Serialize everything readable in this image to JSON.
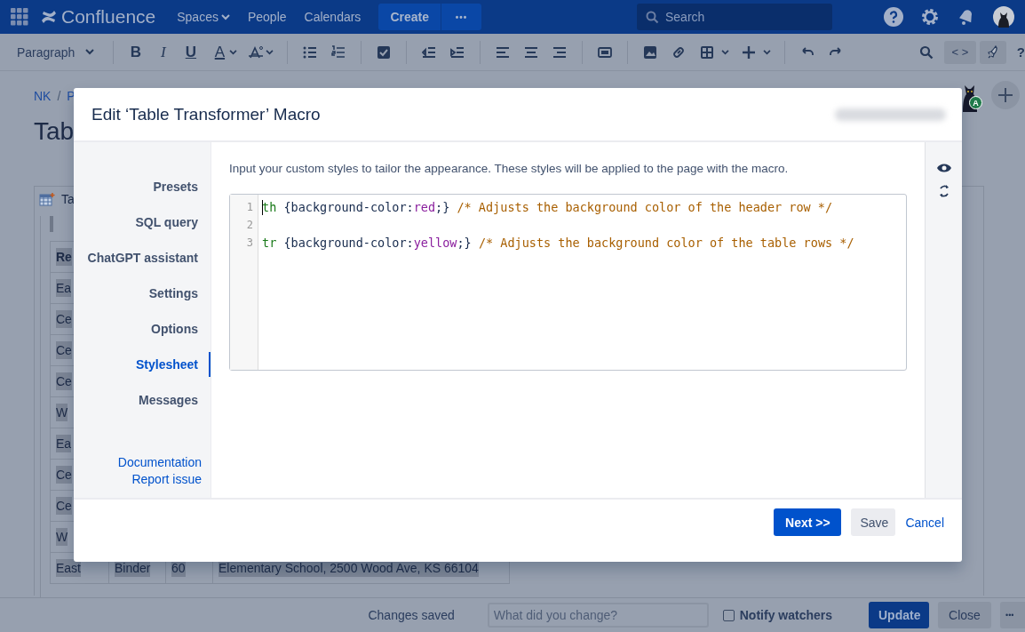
{
  "header": {
    "product": "Confluence",
    "nav": [
      {
        "label": "Spaces",
        "dropdown": true
      },
      {
        "label": "People",
        "dropdown": false
      },
      {
        "label": "Calendars",
        "dropdown": false
      }
    ],
    "create_button": "Create",
    "more_button": "•••",
    "search": {
      "placeholder": "Search"
    }
  },
  "toolbar": {
    "format": "Paragraph",
    "text_buttons": [
      {
        "label": "B",
        "kind": "bold"
      },
      {
        "label": "I",
        "kind": "italic"
      },
      {
        "label": "U",
        "kind": "underline"
      },
      {
        "label": "A",
        "kind": "color"
      }
    ],
    "source_button": "< >",
    "help": "?"
  },
  "page": {
    "breadcrumb": [
      "NK",
      "/",
      "P"
    ],
    "title": "Tab",
    "table_caption": "Ta",
    "table_columns": [
      "Re"
    ],
    "table_rows": [
      [
        "Ea"
      ],
      [
        "Ce"
      ],
      [
        "Ce"
      ],
      [
        "Ce"
      ],
      [
        "W"
      ],
      [
        "Ea"
      ],
      [
        "Ce"
      ],
      [
        "Ce"
      ],
      [
        "W"
      ],
      [
        "East",
        "Binder",
        "60",
        "Elementary School, 2500 Wood Ave, KS 66104"
      ]
    ],
    "avatar_badge": "A"
  },
  "bottom_bar": {
    "status": "Changes saved",
    "comment": {
      "placeholder": "What did you change?"
    },
    "notify": {
      "label": "Notify watchers",
      "checked": false
    },
    "update_button": "Update",
    "close_button": "Close",
    "more_button": "•••"
  },
  "dialog": {
    "title": "Edit ‘Table Transformer’ Macro",
    "nav": [
      {
        "label": "Presets",
        "selected": false
      },
      {
        "label": "SQL query",
        "selected": false
      },
      {
        "label": "ChatGPT assistant",
        "selected": false
      },
      {
        "label": "Settings",
        "selected": false
      },
      {
        "label": "Options",
        "selected": false
      },
      {
        "label": "Stylesheet",
        "selected": true
      },
      {
        "label": "Messages",
        "selected": false
      }
    ],
    "links": [
      "Documentation",
      "Report issue"
    ],
    "description": "Input your custom styles to tailor the appearance. These styles will be applied to the page with the macro.",
    "code_lines": [
      {
        "number": "1",
        "tokens": [
          {
            "kind": "tag",
            "text": "th"
          },
          {
            "kind": "plain",
            "text": " {background-color:"
          },
          {
            "kind": "value",
            "text": "red"
          },
          {
            "kind": "plain",
            "text": ";} "
          },
          {
            "kind": "comment",
            "text": "/* Adjusts the background color of the header row */"
          }
        ]
      },
      {
        "number": "2"
      },
      {
        "number": "3",
        "tokens": [
          {
            "kind": "tag",
            "text": "tr"
          },
          {
            "kind": "plain",
            "text": " {background-color:"
          },
          {
            "kind": "value",
            "text": "yellow"
          },
          {
            "kind": "plain",
            "text": ";} "
          },
          {
            "kind": "comment",
            "text": "/* Adjusts the background color of the table rows */"
          }
        ]
      }
    ],
    "buttons": [
      {
        "label": "Next >>",
        "kind": "primary"
      },
      {
        "label": "Save",
        "kind": "default"
      },
      {
        "label": "Cancel",
        "kind": "link"
      }
    ]
  }
}
